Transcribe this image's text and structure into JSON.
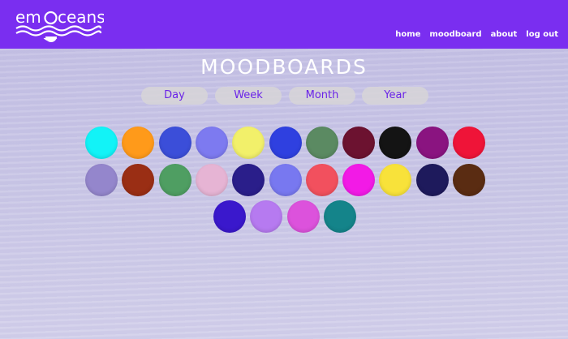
{
  "app": {
    "logo_text": "emOceans",
    "nav": [
      "home",
      "moodboard",
      "about",
      "log out"
    ]
  },
  "page": {
    "title": "MOODBOARDS",
    "tabs": [
      "Day",
      "Week",
      "Month",
      "Year"
    ]
  },
  "mood_colors": {
    "row1": [
      "#12f3f7",
      "#ff9a1a",
      "#3b4ed9",
      "#7d7af0",
      "#f2f06a",
      "#2f40e0",
      "#5b8a62",
      "#6c1230",
      "#141414",
      "#8a1480",
      "#ef1438"
    ],
    "row2": [
      "#9486cc",
      "#9a2e14",
      "#4f9e62",
      "#e6b4d4",
      "#2a1e8a",
      "#7878f0",
      "#f2505e",
      "#f21ae6",
      "#f8e23a",
      "#1e1a5c",
      "#5a2c12"
    ],
    "row3": [
      "#3a18cc",
      "#b67af0",
      "#dc52dc",
      "#14848a"
    ]
  },
  "colors": {
    "header": "#7a2ef0",
    "background": "#c9c6e6",
    "tab_text": "#6a23e8",
    "tab_bg": "#d7d5d7"
  }
}
